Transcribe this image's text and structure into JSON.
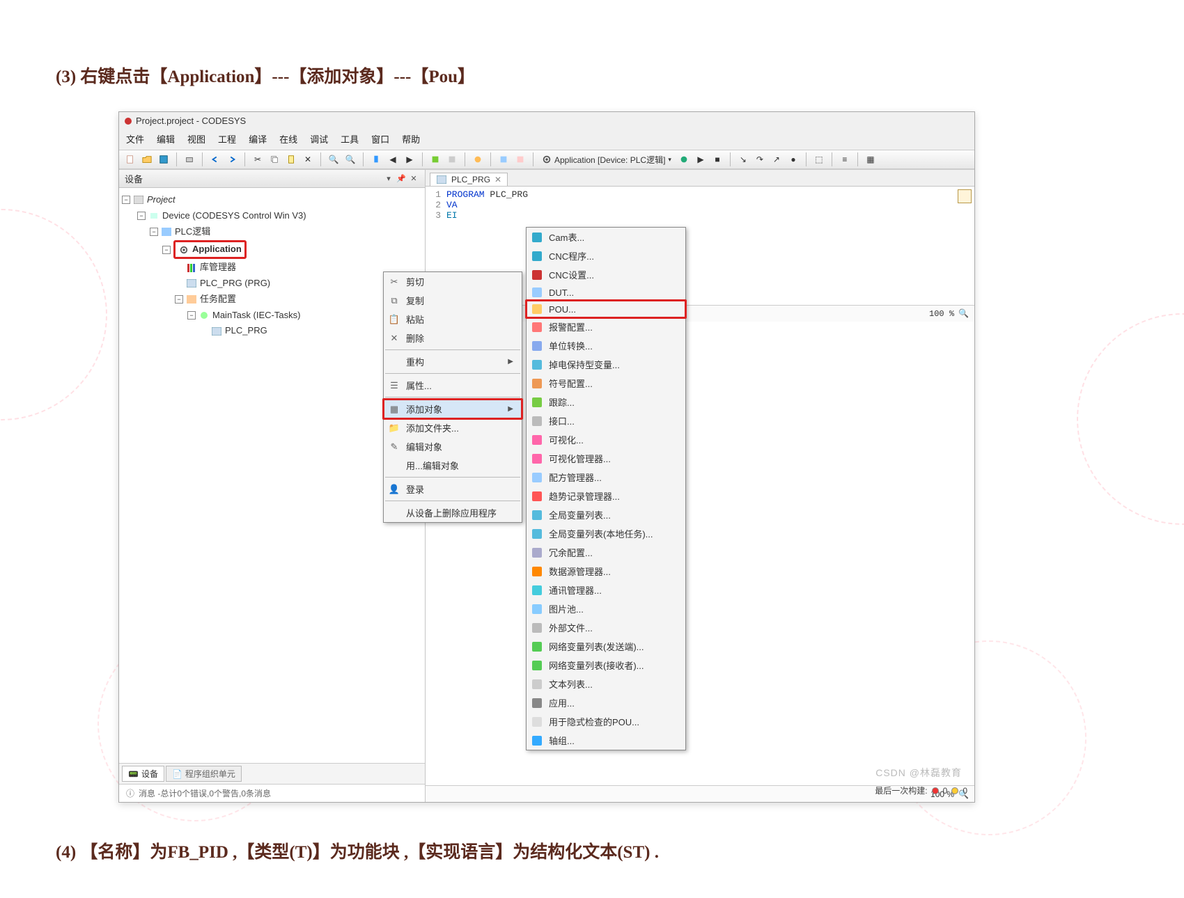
{
  "article": {
    "step3": "(3) 右键点击【Application】---【添加对象】---【Pou】",
    "step4": "(4) 【名称】为FB_PID ,【类型(T)】为功能块 ,【实现语言】为结构化文本(ST) ."
  },
  "window": {
    "title": "Project.project - CODESYS",
    "menus": [
      "文件",
      "编辑",
      "视图",
      "工程",
      "编译",
      "在线",
      "调试",
      "工具",
      "窗口",
      "帮助"
    ],
    "app_selector": "Application [Device: PLC逻辑]"
  },
  "devices_panel": {
    "title": "设备",
    "tree": {
      "project": "Project",
      "device": "Device (CODESYS Control Win V3)",
      "plc_logic": "PLC逻辑",
      "application": "Application",
      "lib_mgr": "库管理器",
      "plc_prg": "PLC_PRG (PRG)",
      "task_cfg": "任务配置",
      "maintask": "MainTask (IEC-Tasks)",
      "plc_prg2": "PLC_PRG"
    },
    "tabs": {
      "active": "设备",
      "inactive": "程序组织单元"
    },
    "status": "消息 -总计0个错误,0个警告,0条消息"
  },
  "editor": {
    "tab": "PLC_PRG",
    "lines": [
      {
        "no": "1",
        "kw": "PROGRAM",
        "rest": " PLC_PRG"
      },
      {
        "no": "2",
        "kw": "VA",
        "rest": ""
      },
      {
        "no": "3",
        "kw": "EI",
        "rest": ""
      }
    ],
    "zoom_a": "100 %",
    "zoom_b": "100 %"
  },
  "context_menu": {
    "items": [
      {
        "icon": "cut-icon",
        "label": "剪切"
      },
      {
        "icon": "copy-icon",
        "label": "复制"
      },
      {
        "icon": "paste-icon",
        "label": "粘贴"
      },
      {
        "icon": "delete-icon",
        "label": "删除"
      },
      {
        "sep": true
      },
      {
        "icon": "",
        "label": "重构",
        "arrow": true
      },
      {
        "sep": true
      },
      {
        "icon": "properties-icon",
        "label": "属性..."
      },
      {
        "sep": true
      },
      {
        "icon": "add-object-icon",
        "label": "添加对象",
        "arrow": true,
        "highlight": true,
        "red": true
      },
      {
        "icon": "folder-icon",
        "label": "添加文件夹..."
      },
      {
        "icon": "edit-object-icon",
        "label": "编辑对象"
      },
      {
        "icon": "",
        "label": "用...编辑对象"
      },
      {
        "sep": true
      },
      {
        "icon": "login-icon",
        "label": "登录"
      },
      {
        "sep": true
      },
      {
        "icon": "",
        "label": "从设备上删除应用程序"
      }
    ]
  },
  "submenu": {
    "items": [
      {
        "icon": "cam-icon",
        "label": "Cam表..."
      },
      {
        "icon": "cnc-prog-icon",
        "label": "CNC程序..."
      },
      {
        "icon": "cnc-set-icon",
        "label": "CNC设置..."
      },
      {
        "icon": "dut-icon",
        "label": "DUT..."
      },
      {
        "icon": "pou-icon",
        "label": "POU...",
        "red": true
      },
      {
        "icon": "alarm-icon",
        "label": "报警配置..."
      },
      {
        "icon": "unit-icon",
        "label": "单位转换..."
      },
      {
        "icon": "persist-icon",
        "label": "掉电保持型变量..."
      },
      {
        "icon": "symbol-icon",
        "label": "符号配置..."
      },
      {
        "icon": "trace-icon",
        "label": "跟踪..."
      },
      {
        "icon": "interface-icon",
        "label": "接口..."
      },
      {
        "icon": "visu-icon",
        "label": "可视化..."
      },
      {
        "icon": "visumgr-icon",
        "label": "可视化管理器..."
      },
      {
        "icon": "recipe-icon",
        "label": "配方管理器..."
      },
      {
        "icon": "trend-icon",
        "label": "趋势记录管理器..."
      },
      {
        "icon": "gvl-icon",
        "label": "全局变量列表..."
      },
      {
        "icon": "gvl-local-icon",
        "label": "全局变量列表(本地任务)..."
      },
      {
        "icon": "redundancy-icon",
        "label": "冗余配置..."
      },
      {
        "icon": "datasrc-icon",
        "label": "数据源管理器..."
      },
      {
        "icon": "comm-icon",
        "label": "通讯管理器..."
      },
      {
        "icon": "imagepool-icon",
        "label": "图片池..."
      },
      {
        "icon": "extfile-icon",
        "label": "外部文件..."
      },
      {
        "icon": "netvars-icon",
        "label": "网络变量列表(发送端)..."
      },
      {
        "icon": "netvarr-icon",
        "label": "网络变量列表(接收者)..."
      },
      {
        "icon": "textlist-icon",
        "label": "文本列表..."
      },
      {
        "icon": "app-icon",
        "label": "应用..."
      },
      {
        "icon": "implicit-icon",
        "label": "用于隐式检查的POU..."
      },
      {
        "icon": "axisgrp-icon",
        "label": "轴组..."
      }
    ]
  },
  "status_bar": {
    "last_build": "最后一次构建:",
    "e": "0",
    "w": "0"
  },
  "csdn": "CSDN @林磊教育"
}
